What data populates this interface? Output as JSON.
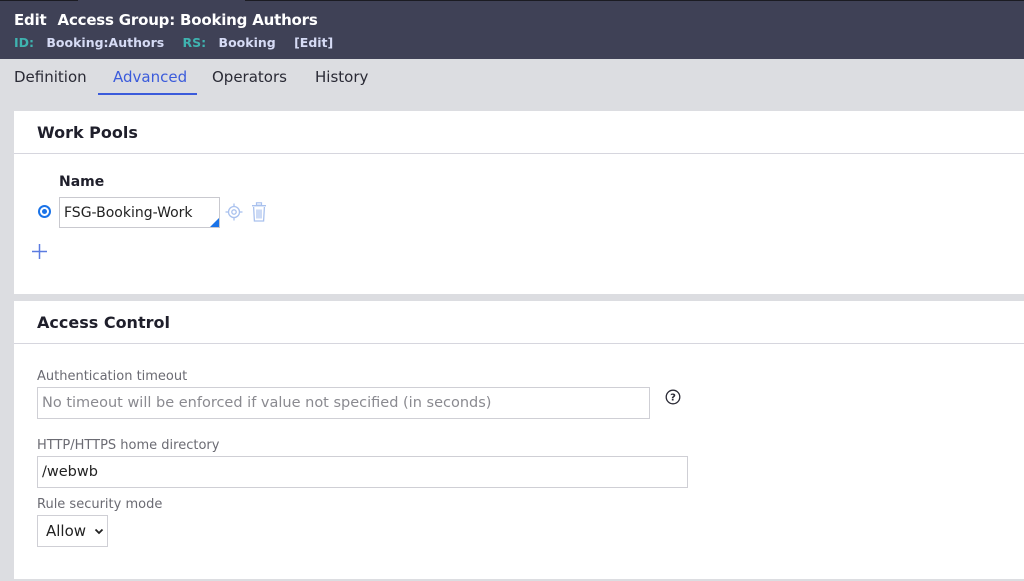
{
  "header": {
    "edit_label": "Edit",
    "title": "Access Group: Booking Authors",
    "id_label": "ID:",
    "id_value": "Booking:Authors",
    "rs_label": "RS:",
    "rs_value": "Booking",
    "edit_link": "[Edit]"
  },
  "tabs": [
    {
      "label": "Definition",
      "active": false
    },
    {
      "label": "Advanced",
      "active": true
    },
    {
      "label": "Operators",
      "active": false
    },
    {
      "label": "History",
      "active": false
    }
  ],
  "work_pools": {
    "title": "Work Pools",
    "column_header": "Name",
    "rows": [
      {
        "selected": true,
        "name": "FSG-Booking-Work"
      }
    ],
    "icons": {
      "target": "target-icon",
      "delete": "trash-icon",
      "add": "plus-icon"
    }
  },
  "access_control": {
    "title": "Access Control",
    "auth_timeout": {
      "label": "Authentication timeout",
      "value": "",
      "placeholder": "No timeout will be enforced if value not specified (in seconds)"
    },
    "home_directory": {
      "label": "HTTP/HTTPS home directory",
      "value": "/webwb"
    },
    "rule_security_mode": {
      "label": "Rule security mode",
      "selected": "Allow"
    },
    "help_icon": "help-circle-icon"
  },
  "colors": {
    "header_bg": "#3f4156",
    "accent": "#3b5bdb",
    "radio": "#1a73e8",
    "meta_key": "#3fb3b0"
  }
}
